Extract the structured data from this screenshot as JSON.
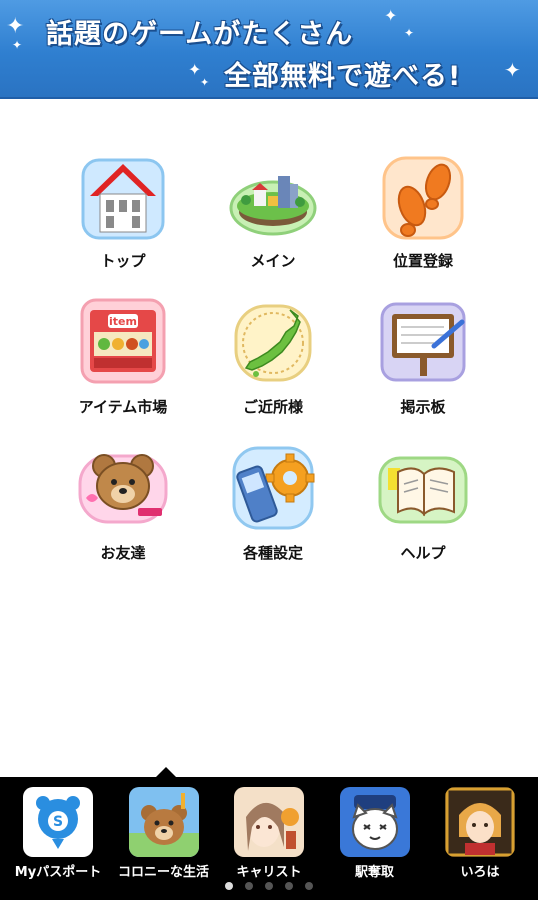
{
  "banner": {
    "line1": "話題のゲームがたくさん",
    "line2": "全部無料で遊べる!",
    "background": "#2f7fd0"
  },
  "menu": [
    {
      "label": "トップ",
      "icon": "house-icon"
    },
    {
      "label": "メイン",
      "icon": "town-icon"
    },
    {
      "label": "位置登録",
      "icon": "footprints-icon"
    },
    {
      "label": "アイテム市場",
      "icon": "item-shop-icon",
      "badge": "item"
    },
    {
      "label": "ご近所様",
      "icon": "japan-map-icon"
    },
    {
      "label": "掲示板",
      "icon": "signboard-icon"
    },
    {
      "label": "お友達",
      "icon": "bear-icon"
    },
    {
      "label": "各種設定",
      "icon": "phone-gear-icon"
    },
    {
      "label": "ヘルプ",
      "icon": "book-icon"
    }
  ],
  "apps": [
    {
      "label": "Myパスポート",
      "icon": "passport-app-icon"
    },
    {
      "label": "コロニーな生活",
      "icon": "colony-app-icon"
    },
    {
      "label": "キャリスト",
      "icon": "carist-app-icon"
    },
    {
      "label": "駅奪取",
      "icon": "ekidash-app-icon"
    },
    {
      "label": "いろは",
      "icon": "iroha-app-icon"
    }
  ],
  "pager": {
    "count": 5,
    "active": 1
  }
}
